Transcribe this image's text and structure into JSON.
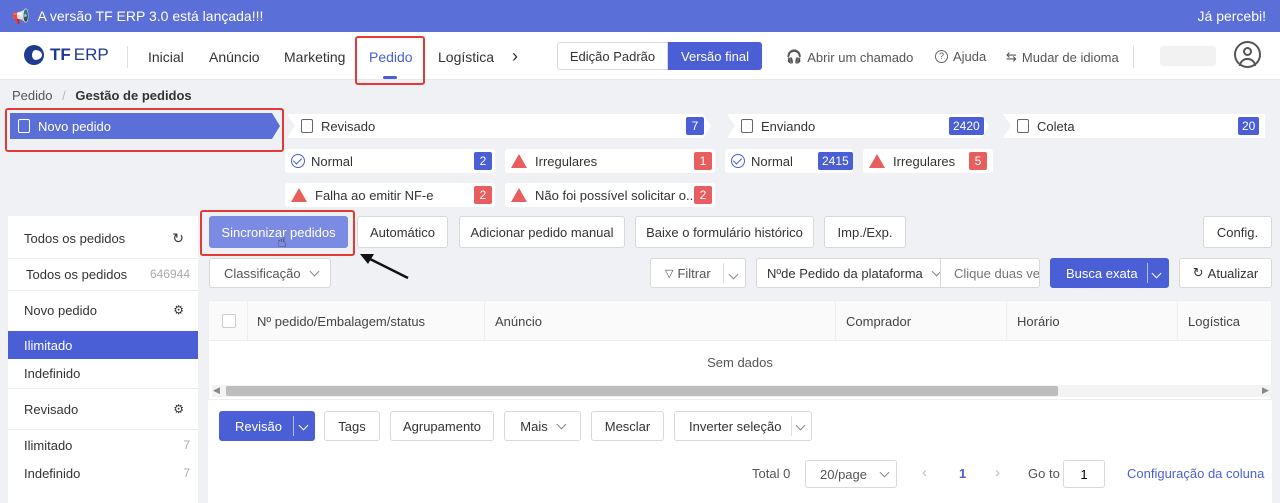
{
  "banner": {
    "message": "A versão TF ERP 3.0 está lançada!!!",
    "ack": "Já percebi!",
    "icon": "megaphone-icon"
  },
  "brand": {
    "name": "TF",
    "suffix": "ERP"
  },
  "nav": {
    "items": [
      "Inicial",
      "Anúncio",
      "Marketing",
      "Pedido",
      "Logística"
    ],
    "active": "Pedido"
  },
  "edition": {
    "standard": "Edição Padrão",
    "final": "Versão final"
  },
  "header_links": {
    "ticket": "Abrir um chamado",
    "help": "Ajuda",
    "language": "Mudar de idioma"
  },
  "breadcrumb": {
    "root": "Pedido",
    "separator": "/",
    "current": "Gestão de pedidos"
  },
  "flow": {
    "new_order": "Novo pedido",
    "reviewed": {
      "label": "Revisado",
      "count": "7"
    },
    "shipping": {
      "label": "Enviando",
      "count": "2420"
    },
    "pickup": {
      "label": "Coleta",
      "count": "20"
    },
    "reviewed_normal": {
      "label": "Normal",
      "count": "2"
    },
    "reviewed_irregular": {
      "label": "Irregulares",
      "count": "1"
    },
    "nfe_fail": {
      "label": "Falha ao emitir NF-e",
      "count": "2"
    },
    "request_fail": {
      "label": "Não foi possível solicitar o...",
      "count": "2"
    },
    "shipping_normal": {
      "label": "Normal",
      "count": "2415"
    },
    "shipping_irregular": {
      "label": "Irregulares",
      "count": "5"
    }
  },
  "sidebar": {
    "all_orders_title": "Todos os pedidos",
    "all_orders_item": "Todos os pedidos",
    "all_orders_count": "646944",
    "new_order_title": "Novo pedido",
    "limited": "Ilimitado",
    "undefined": "Indefinido",
    "reviewed_title": "Revisado",
    "rev_limited": "Ilimitado",
    "rev_limited_count": "7",
    "rev_undefined": "Indefinido",
    "rev_undefined_count": "7"
  },
  "toolbar": {
    "sync": "Sincronizar pedidos",
    "auto": "Automático",
    "manual": "Adicionar pedido manual",
    "history": "Baixe o formulário histórico",
    "impexp": "Imp./Exp.",
    "config": "Config."
  },
  "filters": {
    "sort": "Classificação",
    "filter": "Filtrar",
    "field": "Nºde Pedido da plataforma",
    "search_placeholder": "Clique duas vezes",
    "exact_search": "Busca exata",
    "refresh": "Atualizar"
  },
  "table": {
    "columns": [
      "Nº pedido/Embalagem/status",
      "Anúncio",
      "Comprador",
      "Horário",
      "Logística"
    ],
    "empty": "Sem dados"
  },
  "actions": {
    "review": "Revisão",
    "tags": "Tags",
    "group": "Agrupamento",
    "more": "Mais",
    "merge": "Mesclar",
    "invert": "Inverter seleção"
  },
  "pagination": {
    "total": "Total 0",
    "page_size": "20/page",
    "current": "1",
    "goto": "Go to",
    "goto_value": "1",
    "column_config": "Configuração da coluna"
  }
}
